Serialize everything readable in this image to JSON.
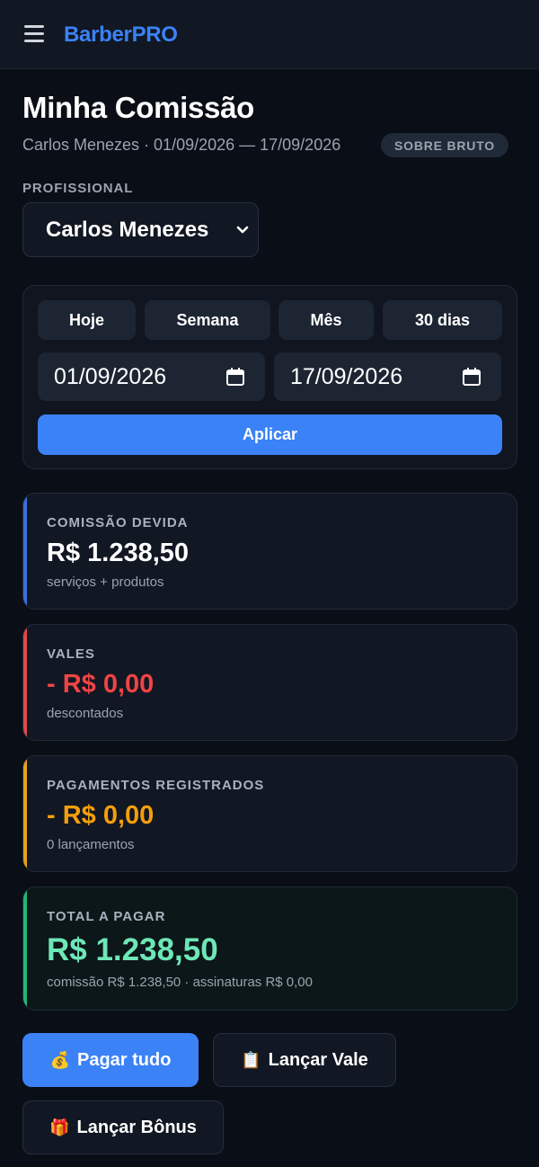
{
  "header": {
    "brand": "BarberPRO"
  },
  "page": {
    "title": "Minha Comissão",
    "subtitle": "Carlos Menezes · 01/09/2026 — 17/09/2026",
    "badge": "SOBRE BRUTO"
  },
  "professional": {
    "label": "PROFISSIONAL",
    "selected": "Carlos Menezes"
  },
  "filters": {
    "quick": [
      "Hoje",
      "Semana",
      "Mês",
      "30 dias"
    ],
    "start_date": "01/09/2026",
    "end_date": "17/09/2026",
    "apply_label": "Aplicar"
  },
  "stats": {
    "commission": {
      "label": "COMISSÃO DEVIDA",
      "value": "R$ 1.238,50",
      "note": "serviços + produtos",
      "accent": "#3b6fe0"
    },
    "vales": {
      "label": "VALES",
      "value": "- R$ 0,00",
      "note": "descontados",
      "accent": "#e0484f"
    },
    "payments": {
      "label": "PAGAMENTOS REGISTRADOS",
      "value": "- R$ 0,00",
      "note": "0 lançamentos",
      "accent": "#e5a21c"
    },
    "total": {
      "label": "TOTAL A PAGAR",
      "value": "R$ 1.238,50",
      "note": "comissão R$ 1.238,50 · assinaturas R$ 0,00",
      "accent": "#22b67a"
    }
  },
  "actions": {
    "pay_all": {
      "icon": "💰",
      "label": "Pagar tudo"
    },
    "add_vale": {
      "icon": "📋",
      "label": "Lançar Vale"
    },
    "add_bonus": {
      "icon": "🎁",
      "label": "Lançar Bônus"
    }
  },
  "colors": {
    "brand": "#3b82f6",
    "commission_value": "#ffffff",
    "vales_value": "#ef4444",
    "payments_value": "#f59e0b",
    "total_value": "#6ee7b7"
  }
}
